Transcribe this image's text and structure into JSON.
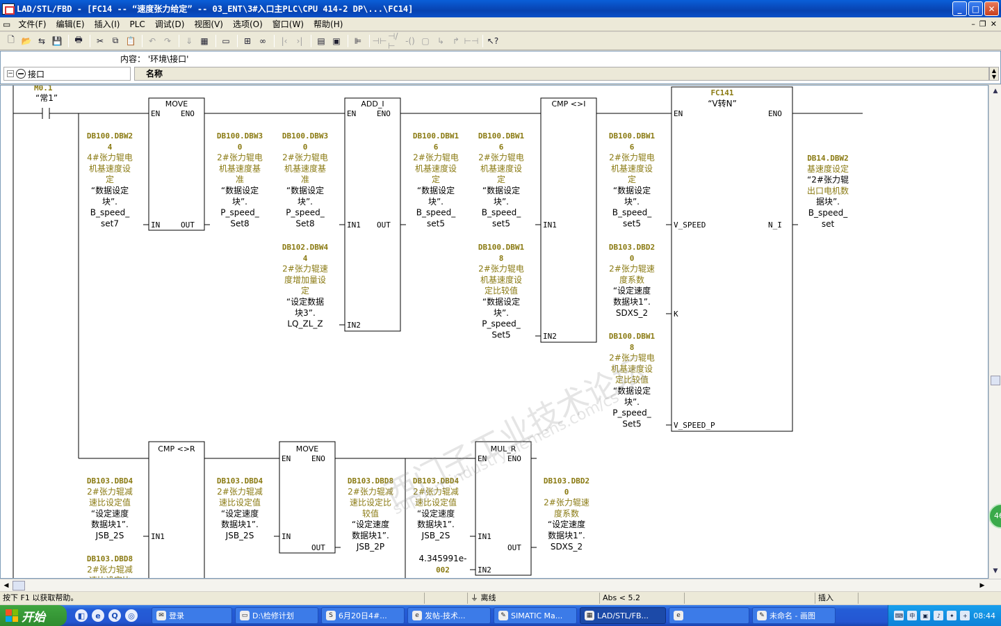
{
  "window": {
    "title": "LAD/STL/FBD  - [FC14 -- “速度张力给定” -- 03_ENT\\3#入口主PLC\\CPU 414-2 DP\\...\\FC14]",
    "buttons": {
      "minimize": "_",
      "maximize": "□",
      "close": "✕"
    }
  },
  "menubar": {
    "items": [
      "文件(F)",
      "编辑(E)",
      "插入(I)",
      "PLC",
      "调试(D)",
      "视图(V)",
      "选项(O)",
      "窗口(W)",
      "帮助(H)"
    ],
    "mdi": {
      "min": "–",
      "restore": "❐",
      "close": "✕"
    }
  },
  "toolbar": {
    "icons": [
      "new-icon",
      "open-icon",
      "accessible-icon",
      "save-icon",
      "print-icon",
      "cut-icon",
      "copy-icon",
      "paste-icon",
      "undo-icon",
      "redo-icon",
      "download-icon",
      "monitor-icon",
      "overview-icon",
      "network-icon",
      "glasses-icon",
      "first-icon",
      "last-icon",
      "window-icon",
      "catalog-icon",
      "ladder-icon",
      "contact-no-icon",
      "contact-nc-icon",
      "coil-icon",
      "box-icon",
      "branch-open-icon",
      "branch-close-icon",
      "connect-icon",
      "help-pointer-icon"
    ]
  },
  "interface": {
    "content_label": "内容：  '环境\\接口'",
    "tree_item": "接口",
    "column_header": "名称",
    "toggle": "−"
  },
  "ladder": {
    "rung1": {
      "contact": {
        "address": "M0.1",
        "symbol": "“常1”"
      },
      "move": {
        "title": "MOVE",
        "en": "EN",
        "eno": "ENO",
        "in": "IN",
        "out": "OUT",
        "in_wire": [
          "DB100.DBW2",
          "4",
          "4#张力辊电",
          "机基速度设",
          "定",
          "“数据设定",
          "块”.",
          "B_speed_",
          "set7"
        ],
        "out_wire": [
          "DB100.DBW3",
          "0",
          "2#张力辊电",
          "机基速度基",
          "准",
          "“数据设定",
          "块”.",
          "P_speed_",
          "Set8"
        ]
      },
      "add": {
        "title": "ADD_I",
        "en": "EN",
        "eno": "ENO",
        "in1": "IN1",
        "in2": "IN2",
        "out": "OUT",
        "in1_wire": [
          "DB100.DBW3",
          "0",
          "2#张力辊电",
          "机基速度基",
          "准",
          "“数据设定",
          "块”.",
          "P_speed_",
          "Set8"
        ],
        "in2_wire": [
          "DB102.DBW4",
          "4",
          "2#张力辊速",
          "度增加量设",
          "定",
          "“设定数据",
          "块3”.",
          "LQ_ZL_Z"
        ],
        "out_wire": [
          "DB100.DBW1",
          "6",
          "2#张力辊电",
          "机基速度设",
          "定",
          "“数据设定",
          "块”.",
          "B_speed_",
          "set5"
        ]
      },
      "cmp": {
        "title": "CMP <>I",
        "in1": "IN1",
        "in2": "IN2",
        "in1_wire": [
          "DB100.DBW1",
          "6",
          "2#张力辊电",
          "机基速度设",
          "定",
          "“数据设定",
          "块”.",
          "B_speed_",
          "set5"
        ],
        "in2_wire": [
          "DB100.DBW1",
          "8",
          "2#张力辊电",
          "机基速度设",
          "定比较值",
          "“数据设定",
          "块”.",
          "P_speed_",
          "Set5"
        ]
      },
      "fc": {
        "title": "FC141",
        "symbol": "“V转N”",
        "en": "EN",
        "eno": "ENO",
        "v_speed": "V_SPEED",
        "k": "K",
        "v_speed_p": "V_SPEED_P",
        "n_i": "N_I",
        "v_speed_wire": [
          "DB100.DBW1",
          "6",
          "2#张力辊电",
          "机基速度设",
          "定",
          "“数据设定",
          "块”.",
          "B_speed_",
          "set5"
        ],
        "k_wire": [
          "DB103.DBD2",
          "0",
          "2#张力辊速",
          "度系数",
          "“设定速度",
          "数据块1”.",
          "SDXS_2"
        ],
        "v_speed_p_wire": [
          "DB100.DBW1",
          "8",
          "2#张力辊电",
          "机基速度设",
          "定比较值",
          "“数据设定",
          "块”.",
          "P_speed_",
          "Set5"
        ],
        "n_i_wire": [
          "DB14.DBW2",
          "基速度设定",
          "“2#张力辊",
          "出口电机数",
          "据块”.",
          "B_speed_",
          "set"
        ]
      }
    },
    "rung2": {
      "cmpr": {
        "title": "CMP <>R",
        "in1": "IN1",
        "in1_wire": [
          "DB103.DBD4",
          "2#张力辊减",
          "速比设定值",
          "“设定速度",
          "数据块1”.",
          "JSB_2S"
        ],
        "in2_wire": [
          "DB103.DBD8",
          "2#张力辊减",
          "速比设定比"
        ]
      },
      "move": {
        "title": "MOVE",
        "en": "EN",
        "eno": "ENO",
        "in": "IN",
        "out": "OUT",
        "in_wire": [
          "DB103.DBD4",
          "2#张力辊减",
          "速比设定值",
          "“设定速度",
          "数据块1”.",
          "JSB_2S"
        ],
        "out_wire": [
          "DB103.DBD8",
          "2#张力辊减",
          "速比设定比",
          "较值",
          "“设定速度",
          "数据块1”.",
          "JSB_2P"
        ]
      },
      "mul": {
        "title": "MUL_R",
        "en": "EN",
        "eno": "ENO",
        "in1": "IN1",
        "in2": "IN2",
        "out": "OUT",
        "in1_wire": [
          "DB103.DBD4",
          "2#张力辊减",
          "速比设定值",
          "“设定速度",
          "数据块1”.",
          "JSB_2S"
        ],
        "in2_wire": [
          "4.345991e-",
          "002"
        ],
        "out_wire": [
          "DB103.DBD2",
          "0",
          "2#张力辊速",
          "度系数",
          "“设定速度",
          "数据块1”.",
          "SDXS_2"
        ]
      }
    }
  },
  "watermark": {
    "cn": "西门子工业技术论坛",
    "url": "support.industry.siemens.com/cs"
  },
  "side_badge": "46",
  "statusbar": {
    "help": "按下 F1 以获取帮助。",
    "mode": "离线",
    "pos": "Abs < 5.2",
    "insert": "插入"
  },
  "taskbar": {
    "start": "开始",
    "tasks": [
      {
        "label": "登录",
        "icon": "wechat-icon"
      },
      {
        "label": "D:\\检修计划",
        "icon": "folder-icon"
      },
      {
        "label": "6月20日4#...",
        "icon": "excel-icon"
      },
      {
        "label": "发帖-技术...",
        "icon": "browser-icon"
      },
      {
        "label": "SIMATIC Ma...",
        "icon": "simatic-icon"
      },
      {
        "label": "LAD/STL/FB...",
        "icon": "lad-icon",
        "active": true
      },
      {
        "label": "",
        "icon": "browser2-icon"
      },
      {
        "label": "未命名 - 画图",
        "icon": "paint-icon"
      }
    ],
    "clock": "08:44"
  }
}
